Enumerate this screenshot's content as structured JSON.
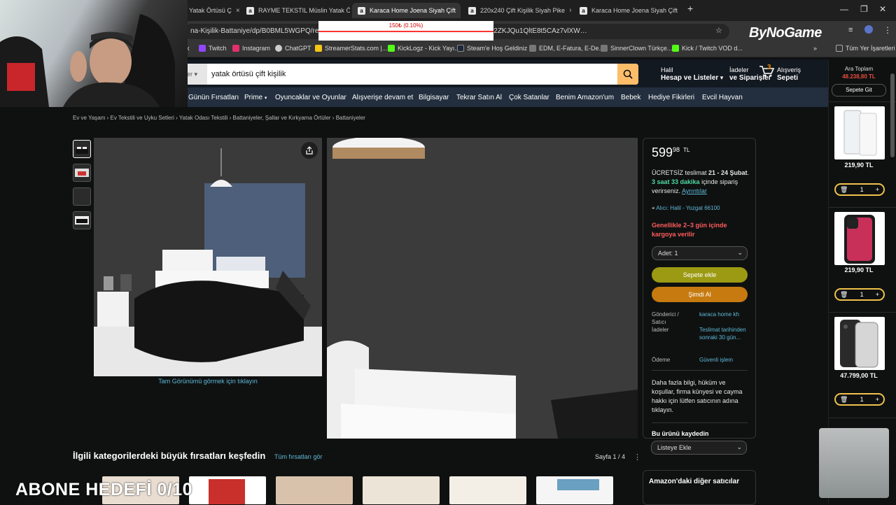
{
  "browser": {
    "tabs": [
      {
        "label": "Yatak Örtüsü Ç",
        "icon": "amazon-favicon"
      },
      {
        "label": "RAYME TEKSTIL Müslin Yatak Ö",
        "icon": "amazon-favicon"
      },
      {
        "label": "Karaca Home Joena Siyah Çift",
        "icon": "amazon-favicon",
        "active": true
      },
      {
        "label": "220x240 Çift Kişilik Siyah Pike",
        "icon": "amazon-favicon"
      },
      {
        "label": "Karaca Home Joena Siyah Çift",
        "icon": "amazon-favicon"
      }
    ],
    "new_tab": "+",
    "url": "na-Kişilik-Battaniye/dp/B0BML5WGPQ/ref=sr_1_…V6q7Olo_qAq0dADNU-GahAQ72t3XnNuWIL82ZKJQu1QltE8t5CAz7vlXW…",
    "overlay_text": "150₺ (0.10%)",
    "bynogame": "ByNoGame",
    "bookmarks": [
      "k",
      "Twitch",
      "Instagram",
      "ChatGPT",
      "StreamerStats.com |...",
      "KickLogz - Kick Yayı...",
      "Steam'e Hoş Geldiniz",
      "EDM, E-Fatura, E-De...",
      "SinnerClown Türkçe...",
      "Kick / Twitch VOD d..."
    ],
    "all_bookmarks": "Tüm Yer İşaretleri",
    "more_bookmarks": "»"
  },
  "header": {
    "search_category": "riler",
    "search_query": "yatak örtüsü çift kişilik",
    "account_line1": "Halil",
    "account_line2": "Hesap ve Listeler",
    "orders_line1": "İadeler",
    "orders_line2": "ve Siparişler",
    "cart_count": "3",
    "cart_line1": "Alışveriş",
    "cart_line2": "Sepeti"
  },
  "nav": [
    "Günün Fırsatları",
    "Prime",
    "Oyuncaklar ve Oyunlar",
    "Alışverişe devam et",
    "Bilgisayar",
    "Tekrar Satın Al",
    "Çok Satanlar",
    "Benim Amazon'um",
    "Bebek",
    "Hediye Fikirleri",
    "Evcil Hayvan"
  ],
  "breadcrumb": "Ev ve Yaşam › Ev Tekstili ve Uyku Setleri › Yatak Odası Tekstili › Battaniyeler, Şallar ve Kırkyama Örtüler › Battaniyeler",
  "gallery": {
    "full_view_link": "Tam Görünümü görmek için tıklayın"
  },
  "buybox": {
    "price_whole": "599",
    "price_fraction": "98",
    "currency": "TL",
    "delivery_1": "ÜCRETSİZ teslimat",
    "delivery_dates": "21 - 24 Şubat",
    "delivery_2": ". ",
    "countdown": "3 saat 33 dakika",
    "delivery_3": " içinde sipariş verirseniz.",
    "details_link": "Ayrıntılar",
    "location": "Alıcı: Halil - Yozgat 66100",
    "shipping_note": "Genellikle 2–3 gün içinde kargoya verilir",
    "qty_label": "Adet: 1",
    "add_to_cart": "Sepete ekle",
    "buy_now": "Şimdi Al",
    "seller_label": "Gönderici / Satıcı",
    "seller_value": "karaca home kh",
    "returns_label": "İadeler",
    "returns_value": "Teslimat tarihinden sonraki 30 gün...",
    "payment_label": "Ödeme",
    "payment_value": "Güvenli işlem",
    "info_text": "Daha fazla bilgi, hüküm ve koşullar, firma künyesi ve cayma hakkı için lütfen satıcının adına tıklayın.",
    "save_title": "Bu ürünü kaydedin",
    "add_to_list": "Listeye Ekle"
  },
  "deals": {
    "title": "İlgili kategorilerdeki büyük fırsatları keşfedin",
    "link": "Tüm fırsatları gör",
    "page": "Sayfa 1 / 4"
  },
  "other_sellers": "Amazon'daki diğer satıcılar",
  "cart": {
    "subtotal_label": "Ara Toplam",
    "subtotal_value": "48.238,80 TL",
    "go_to_cart": "Sepete Git",
    "items": [
      {
        "price": "219,90 TL",
        "qty": "1"
      },
      {
        "price": "219,90 TL",
        "qty": "1"
      },
      {
        "price": "47.799,00 TL",
        "qty": "1"
      }
    ]
  },
  "stream": {
    "abone": "ABONE HEDEFİ 0/10"
  },
  "colors": {
    "amazon_dark": "#131921",
    "amazon_nav": "#232f3e",
    "add_to_cart": "#ffd814",
    "buy_now": "#ffa41c",
    "link": "#5eb8d6",
    "alert_red": "#ff5c5c"
  }
}
